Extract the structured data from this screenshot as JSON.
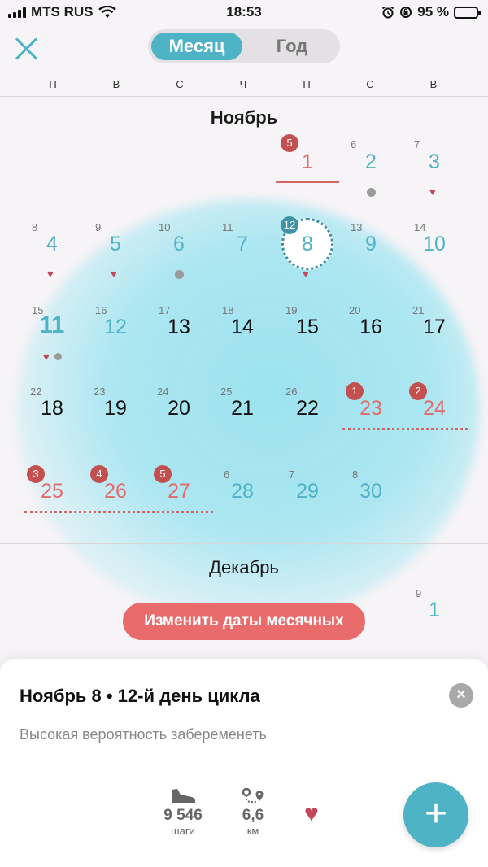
{
  "status_bar": {
    "carrier": "MTS RUS",
    "time": "18:53",
    "battery": "95 %"
  },
  "header": {
    "tabs": [
      {
        "label": "Месяц"
      },
      {
        "label": "Год"
      }
    ]
  },
  "weekdays": [
    "П",
    "В",
    "С",
    "Ч",
    "П",
    "С",
    "В"
  ],
  "november": {
    "title": "Ноябрь",
    "days": {
      "d1": {
        "day": "1",
        "cycle": "5"
      },
      "d2": {
        "day": "2",
        "cycle": "6"
      },
      "d3": {
        "day": "3",
        "cycle": "7"
      },
      "d4": {
        "day": "4",
        "cycle": "8"
      },
      "d5": {
        "day": "5",
        "cycle": "9"
      },
      "d6": {
        "day": "6",
        "cycle": "10"
      },
      "d7": {
        "day": "7",
        "cycle": "11"
      },
      "d8": {
        "day": "8",
        "cycle": "12"
      },
      "d9": {
        "day": "9",
        "cycle": "13"
      },
      "d10": {
        "day": "10",
        "cycle": "14"
      },
      "d11": {
        "day": "11",
        "cycle": "15"
      },
      "d12": {
        "day": "12",
        "cycle": "16"
      },
      "d13": {
        "day": "13",
        "cycle": "17"
      },
      "d14": {
        "day": "14",
        "cycle": "18"
      },
      "d15": {
        "day": "15",
        "cycle": "19"
      },
      "d16": {
        "day": "16",
        "cycle": "20"
      },
      "d17": {
        "day": "17",
        "cycle": "21"
      },
      "d18": {
        "day": "18",
        "cycle": "22"
      },
      "d19": {
        "day": "19",
        "cycle": "23"
      },
      "d20": {
        "day": "20",
        "cycle": "24"
      },
      "d21": {
        "day": "21",
        "cycle": "25"
      },
      "d22": {
        "day": "22",
        "cycle": "26"
      },
      "d23": {
        "day": "23",
        "cycle": "1"
      },
      "d24": {
        "day": "24",
        "cycle": "2"
      },
      "d25": {
        "day": "25",
        "cycle": "3"
      },
      "d26": {
        "day": "26",
        "cycle": "4"
      },
      "d27": {
        "day": "27",
        "cycle": "5"
      },
      "d28": {
        "day": "28",
        "cycle": "6"
      },
      "d29": {
        "day": "29",
        "cycle": "7"
      },
      "d30": {
        "day": "30",
        "cycle": "8"
      }
    }
  },
  "december": {
    "title": "Декабрь",
    "d1": {
      "day": "1",
      "cycle": "9"
    }
  },
  "edit_button": "Изменить даты месячных",
  "sheet": {
    "title": "Ноябрь 8 • 12-й день цикла",
    "subtitle": "Высокая вероятность забеременеть",
    "steps": {
      "value": "9 546",
      "unit": "шаги"
    },
    "distance": {
      "value": "6,6",
      "unit": "км"
    },
    "add": "+"
  },
  "colors": {
    "teal": "#4fb3c6",
    "red": "#e46b6b",
    "badge_red": "#c34f4f",
    "heart": "#c0485a"
  },
  "icons": [
    "signal-icon",
    "wifi-icon",
    "alarm-icon",
    "rotation-lock-icon",
    "battery-icon",
    "close-icon",
    "heart-icon",
    "sneaker-icon",
    "route-icon",
    "plus-icon"
  ]
}
